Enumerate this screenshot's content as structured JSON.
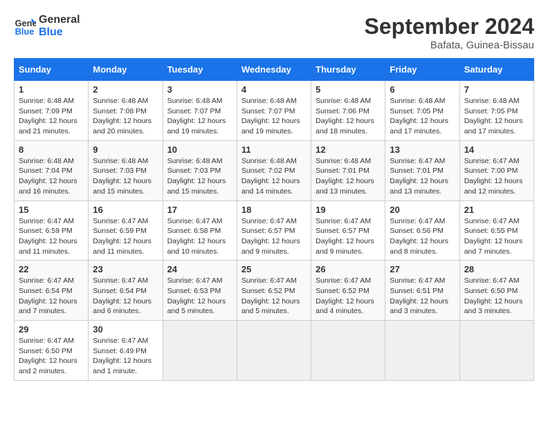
{
  "logo": {
    "line1": "General",
    "line2": "Blue"
  },
  "title": "September 2024",
  "location": "Bafata, Guinea-Bissau",
  "days_of_week": [
    "Sunday",
    "Monday",
    "Tuesday",
    "Wednesday",
    "Thursday",
    "Friday",
    "Saturday"
  ],
  "weeks": [
    [
      {
        "day": "1",
        "sunrise": "6:48 AM",
        "sunset": "7:09 PM",
        "daylight": "12 hours and 21 minutes."
      },
      {
        "day": "2",
        "sunrise": "6:48 AM",
        "sunset": "7:08 PM",
        "daylight": "12 hours and 20 minutes."
      },
      {
        "day": "3",
        "sunrise": "6:48 AM",
        "sunset": "7:07 PM",
        "daylight": "12 hours and 19 minutes."
      },
      {
        "day": "4",
        "sunrise": "6:48 AM",
        "sunset": "7:07 PM",
        "daylight": "12 hours and 19 minutes."
      },
      {
        "day": "5",
        "sunrise": "6:48 AM",
        "sunset": "7:06 PM",
        "daylight": "12 hours and 18 minutes."
      },
      {
        "day": "6",
        "sunrise": "6:48 AM",
        "sunset": "7:05 PM",
        "daylight": "12 hours and 17 minutes."
      },
      {
        "day": "7",
        "sunrise": "6:48 AM",
        "sunset": "7:05 PM",
        "daylight": "12 hours and 17 minutes."
      }
    ],
    [
      {
        "day": "8",
        "sunrise": "6:48 AM",
        "sunset": "7:04 PM",
        "daylight": "12 hours and 16 minutes."
      },
      {
        "day": "9",
        "sunrise": "6:48 AM",
        "sunset": "7:03 PM",
        "daylight": "12 hours and 15 minutes."
      },
      {
        "day": "10",
        "sunrise": "6:48 AM",
        "sunset": "7:03 PM",
        "daylight": "12 hours and 15 minutes."
      },
      {
        "day": "11",
        "sunrise": "6:48 AM",
        "sunset": "7:02 PM",
        "daylight": "12 hours and 14 minutes."
      },
      {
        "day": "12",
        "sunrise": "6:48 AM",
        "sunset": "7:01 PM",
        "daylight": "12 hours and 13 minutes."
      },
      {
        "day": "13",
        "sunrise": "6:47 AM",
        "sunset": "7:01 PM",
        "daylight": "12 hours and 13 minutes."
      },
      {
        "day": "14",
        "sunrise": "6:47 AM",
        "sunset": "7:00 PM",
        "daylight": "12 hours and 12 minutes."
      }
    ],
    [
      {
        "day": "15",
        "sunrise": "6:47 AM",
        "sunset": "6:59 PM",
        "daylight": "12 hours and 11 minutes."
      },
      {
        "day": "16",
        "sunrise": "6:47 AM",
        "sunset": "6:59 PM",
        "daylight": "12 hours and 11 minutes."
      },
      {
        "day": "17",
        "sunrise": "6:47 AM",
        "sunset": "6:58 PM",
        "daylight": "12 hours and 10 minutes."
      },
      {
        "day": "18",
        "sunrise": "6:47 AM",
        "sunset": "6:57 PM",
        "daylight": "12 hours and 9 minutes."
      },
      {
        "day": "19",
        "sunrise": "6:47 AM",
        "sunset": "6:57 PM",
        "daylight": "12 hours and 9 minutes."
      },
      {
        "day": "20",
        "sunrise": "6:47 AM",
        "sunset": "6:56 PM",
        "daylight": "12 hours and 8 minutes."
      },
      {
        "day": "21",
        "sunrise": "6:47 AM",
        "sunset": "6:55 PM",
        "daylight": "12 hours and 7 minutes."
      }
    ],
    [
      {
        "day": "22",
        "sunrise": "6:47 AM",
        "sunset": "6:54 PM",
        "daylight": "12 hours and 7 minutes."
      },
      {
        "day": "23",
        "sunrise": "6:47 AM",
        "sunset": "6:54 PM",
        "daylight": "12 hours and 6 minutes."
      },
      {
        "day": "24",
        "sunrise": "6:47 AM",
        "sunset": "6:53 PM",
        "daylight": "12 hours and 5 minutes."
      },
      {
        "day": "25",
        "sunrise": "6:47 AM",
        "sunset": "6:52 PM",
        "daylight": "12 hours and 5 minutes."
      },
      {
        "day": "26",
        "sunrise": "6:47 AM",
        "sunset": "6:52 PM",
        "daylight": "12 hours and 4 minutes."
      },
      {
        "day": "27",
        "sunrise": "6:47 AM",
        "sunset": "6:51 PM",
        "daylight": "12 hours and 3 minutes."
      },
      {
        "day": "28",
        "sunrise": "6:47 AM",
        "sunset": "6:50 PM",
        "daylight": "12 hours and 3 minutes."
      }
    ],
    [
      {
        "day": "29",
        "sunrise": "6:47 AM",
        "sunset": "6:50 PM",
        "daylight": "12 hours and 2 minutes."
      },
      {
        "day": "30",
        "sunrise": "6:47 AM",
        "sunset": "6:49 PM",
        "daylight": "12 hours and 1 minute."
      },
      null,
      null,
      null,
      null,
      null
    ]
  ]
}
